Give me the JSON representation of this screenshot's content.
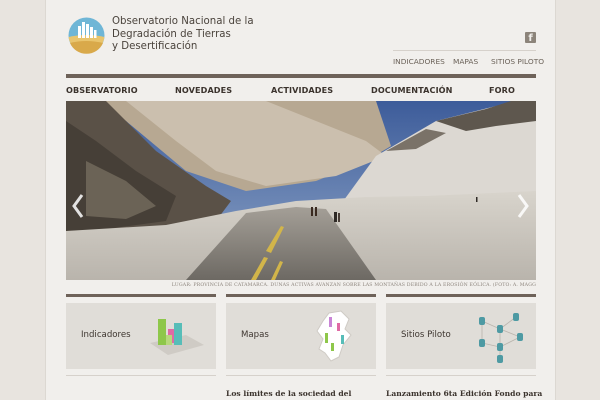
{
  "site": {
    "title_lines": [
      "Observatorio Nacional de la",
      "Degradación de Tierras",
      "y Desertificación"
    ],
    "social_icon": "facebook-icon"
  },
  "utility_nav": [
    {
      "label": "INDICADORES"
    },
    {
      "label": "MAPAS"
    },
    {
      "label": "SITIOS PILOTO"
    }
  ],
  "main_nav": [
    {
      "label": "OBSERVATORIO"
    },
    {
      "label": "NOVEDADES"
    },
    {
      "label": "ACTIVIDADES"
    },
    {
      "label": "DOCUMENTACIÓN"
    },
    {
      "label": "FORO"
    }
  ],
  "slider": {
    "caption": "LUGAR: PROVINCIA DE CATAMARCA. DUNAS ACTIVAS AVANZAN SOBRE LAS MONTAÑAS DEBIDO A LA EROSIÓN EÓLICA. (FOTO: A. MAGG",
    "prev_icon": "chevron-left-icon",
    "next_icon": "chevron-right-icon"
  },
  "feature_boxes": [
    {
      "label": "Indicadores",
      "icon": "bar-chart-icon"
    },
    {
      "label": "Mapas",
      "icon": "map-icon"
    },
    {
      "label": "Sitios Piloto",
      "icon": "network-icon"
    }
  ],
  "news": [
    {
      "title": "Los límites de la sociedad del"
    },
    {
      "title": "Lanzamiento 6ta Edición Fondo para"
    }
  ],
  "colors": {
    "page_background": "#f1efec",
    "accent_bar": "#6e6259",
    "text_dark": "#3b332d"
  }
}
